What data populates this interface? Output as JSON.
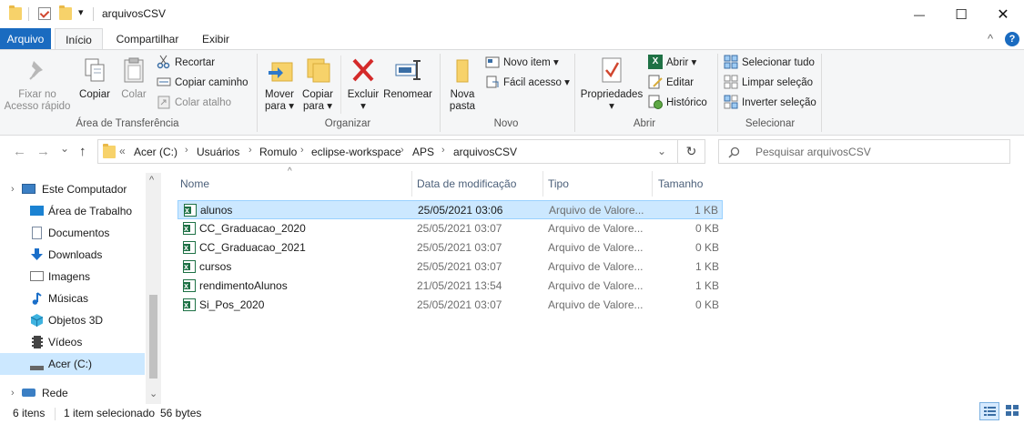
{
  "window": {
    "title": "arquivosCSV",
    "minimize_glyph": "—",
    "maximize_glyph": "☐",
    "close_glyph": "✕"
  },
  "quick_access": {
    "dropdown_glyph": "▾"
  },
  "ribbon_tabs": [
    "Arquivo",
    "Início",
    "Compartilhar",
    "Exibir"
  ],
  "ribbon": {
    "collapse_glyph": "^",
    "help_glyph": "?",
    "clipboard": {
      "pin_label_1": "Fixar no",
      "pin_label_2": "Acesso rápido",
      "copy": "Copiar",
      "paste": "Colar",
      "cut": "Recortar",
      "copy_path": "Copiar caminho",
      "paste_shortcut": "Colar atalho",
      "label": "Área de Transferência"
    },
    "organize": {
      "move_1": "Mover",
      "move_2": "para ▾",
      "copyto_1": "Copiar",
      "copyto_2": "para ▾",
      "delete_1": "Excluir",
      "delete_2": "▾",
      "rename": "Renomear",
      "label": "Organizar"
    },
    "new": {
      "folder_1": "Nova",
      "folder_2": "pasta",
      "new_item": "Novo item ▾",
      "easy_access": "Fácil acesso ▾",
      "label": "Novo"
    },
    "open": {
      "properties_1": "Propriedades",
      "properties_2": "▾",
      "open": "Abrir ▾",
      "edit": "Editar",
      "history": "Histórico",
      "label": "Abrir"
    },
    "select": {
      "select_all": "Selecionar tudo",
      "select_none": "Limpar seleção",
      "invert": "Inverter seleção",
      "label": "Selecionar"
    }
  },
  "navigation": {
    "back": "←",
    "forward": "→",
    "recent": "⌄",
    "up": "↑",
    "breadcrumb_overflow": "«",
    "breadcrumb": [
      "Acer (C:)",
      "Usuários",
      "Romulo",
      "eclipse-workspace",
      "APS",
      "arquivosCSV"
    ],
    "separator": "›",
    "dropdown": "⌄",
    "refresh": "↻",
    "search_placeholder": "Pesquisar arquivosCSV"
  },
  "nav_pane": {
    "items": [
      {
        "label": "Este Computador",
        "icon": "computer-icon"
      },
      {
        "label": "Área de Trabalho",
        "icon": "desktop-icon"
      },
      {
        "label": "Documentos",
        "icon": "documents-icon"
      },
      {
        "label": "Downloads",
        "icon": "downloads-icon"
      },
      {
        "label": "Imagens",
        "icon": "pictures-icon"
      },
      {
        "label": "Músicas",
        "icon": "music-icon"
      },
      {
        "label": "Objetos 3D",
        "icon": "objects-3d-icon"
      },
      {
        "label": "Vídeos",
        "icon": "videos-icon"
      },
      {
        "label": "Acer (C:)",
        "icon": "drive-icon"
      },
      {
        "label": "Rede",
        "icon": "network-icon"
      }
    ],
    "expand_glyph": "›",
    "selected_index": 8,
    "scroll_up": "^",
    "scroll_down": "⌄"
  },
  "file_list": {
    "sort_glyph": "^",
    "columns": [
      "Nome",
      "Data de modificação",
      "Tipo",
      "Tamanho"
    ],
    "rows": [
      {
        "name": "alunos",
        "date": "25/05/2021 03:06",
        "type": "Arquivo de Valore...",
        "size": "1 KB",
        "selected": true
      },
      {
        "name": "CC_Graduacao_2020",
        "date": "25/05/2021 03:07",
        "type": "Arquivo de Valore...",
        "size": "0 KB"
      },
      {
        "name": "CC_Graduacao_2021",
        "date": "25/05/2021 03:07",
        "type": "Arquivo de Valore...",
        "size": "0 KB"
      },
      {
        "name": "cursos",
        "date": "25/05/2021 03:07",
        "type": "Arquivo de Valore...",
        "size": "1 KB"
      },
      {
        "name": "rendimentoAlunos",
        "date": "21/05/2021 13:54",
        "type": "Arquivo de Valore...",
        "size": "1 KB"
      },
      {
        "name": "Si_Pos_2020",
        "date": "25/05/2021 03:07",
        "type": "Arquivo de Valore...",
        "size": "0 KB"
      }
    ]
  },
  "status_bar": {
    "item_count": "6 itens",
    "selection": "1 item selecionado",
    "size": "56 bytes"
  },
  "colors": {
    "accent": "#1a6bc0",
    "selection": "#cce8ff",
    "excel_green": "#1e7145"
  }
}
